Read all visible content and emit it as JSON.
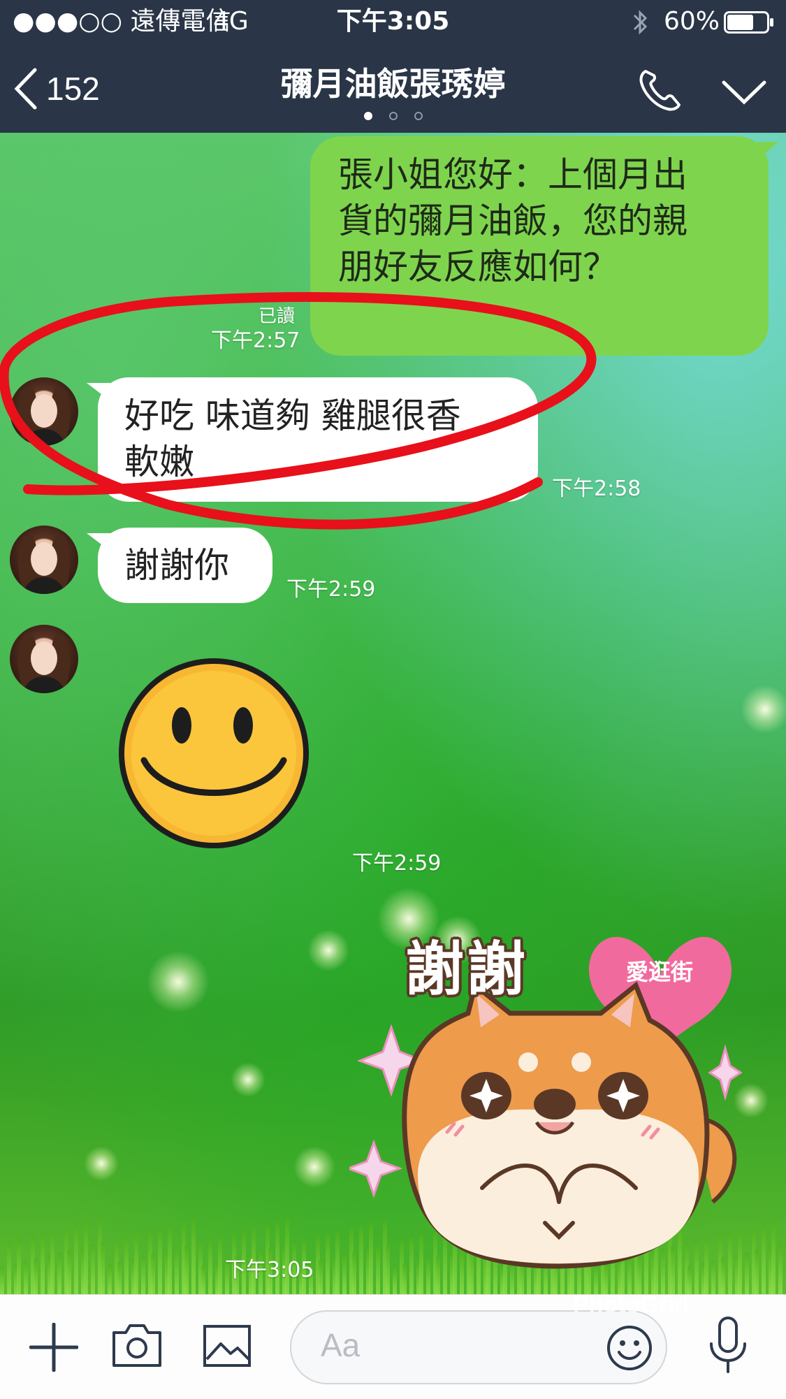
{
  "status_bar": {
    "carrier": "●●●○○ 遠傳電信",
    "network": "4G",
    "time": "下午3:05",
    "battery": "60%",
    "icons": [
      "bluetooth-icon",
      "battery-icon"
    ]
  },
  "nav": {
    "back_count": "152",
    "title": "彌月油飯張琇婷",
    "pages": 3,
    "active_page": 1
  },
  "messages": [
    {
      "direction": "outgoing",
      "text_lines": [
        "張小姐您好：上個月出",
        "貨的彌月油飯，您的親",
        "朋好友反應如何？"
      ],
      "read": "已讀",
      "time": "下午2:57"
    },
    {
      "direction": "incoming",
      "text_lines": [
        "好吃 味道夠 雞腿很香",
        "軟嫩"
      ],
      "time": "下午2:58"
    },
    {
      "direction": "incoming",
      "text_lines": [
        "謝謝你"
      ],
      "time": "下午2:59"
    },
    {
      "direction": "incoming",
      "type": "sticker",
      "sticker": "smiley-face",
      "time": "下午2:59"
    },
    {
      "direction": "outgoing",
      "type": "sticker",
      "sticker": "shiba-thanks",
      "sticker_text": "謝謝",
      "badge_text": "愛逛街",
      "time": "下午3:05"
    }
  ],
  "input": {
    "placeholder": "Aa",
    "tools": [
      "plus-icon",
      "camera-icon",
      "image-icon",
      "emoji-icon",
      "mic-icon"
    ]
  },
  "watermark": "PhotoGrid",
  "colors": {
    "nav_bg": "#2a3547",
    "outgoing_bubble": "#7fd44e",
    "incoming_bubble": "#ffffff",
    "annotation": "#e8101a"
  }
}
